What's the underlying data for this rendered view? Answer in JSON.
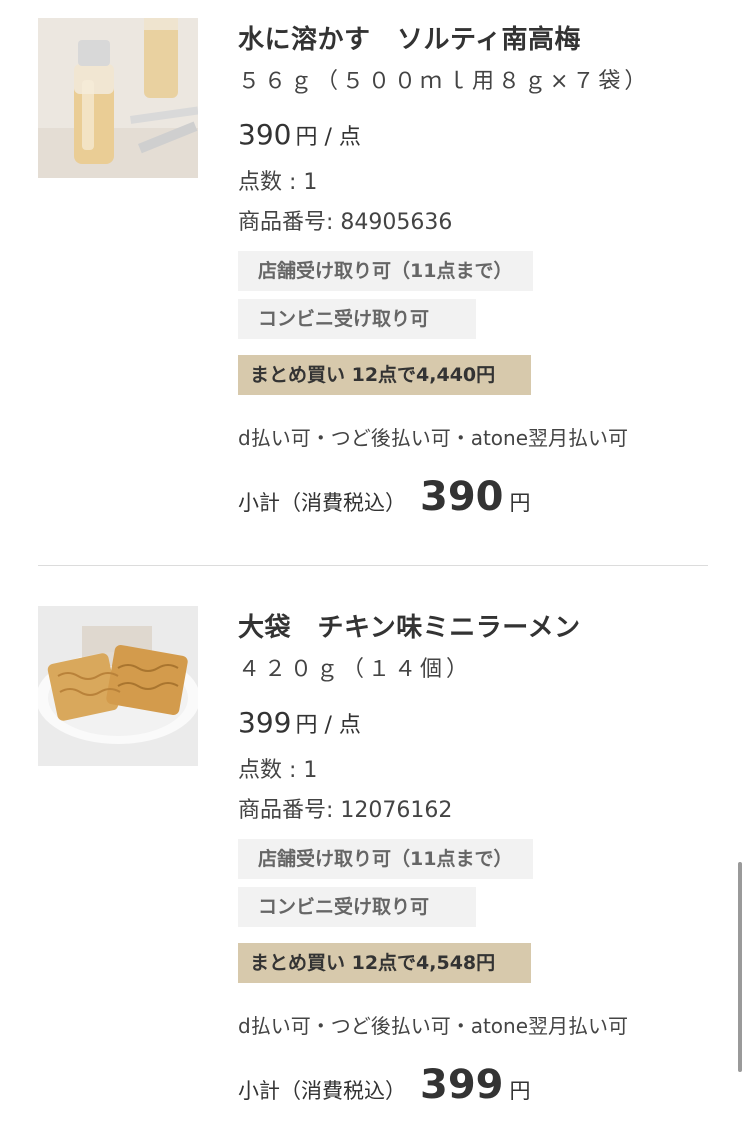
{
  "items": [
    {
      "image_alt": "水に溶かす ソルティ南高梅",
      "title": "水に溶かす　ソルティ南高梅",
      "subtitle": "５６ｇ（５００ｍｌ用８ｇ×７袋）",
      "price": "390",
      "price_unit": "円 / 点",
      "quantity": "点数 : 1",
      "sku": "商品番号: 84905636",
      "tag_store": "店舗受け取り可（11点まで）",
      "tag_conv": "コンビニ受け取り可",
      "tag_bulk": "まとめ買い 12点で4,440円",
      "payment": "d払い可・つど後払い可・atone翌月払い可",
      "subtotal_label": "小計（消費税込）",
      "subtotal_amount": "390",
      "subtotal_yen": "円"
    },
    {
      "image_alt": "大袋 チキン味ミニラーメン",
      "title": "大袋　チキン味ミニラーメン",
      "subtitle": "４２０ｇ（１４個）",
      "price": "399",
      "price_unit": "円 / 点",
      "quantity": "点数 : 1",
      "sku": "商品番号: 12076162",
      "tag_store": "店舗受け取り可（11点まで）",
      "tag_conv": "コンビニ受け取り可",
      "tag_bulk": "まとめ買い 12点で4,548円",
      "payment": "d払い可・つど後払い可・atone翌月払い可",
      "subtotal_label": "小計（消費税込）",
      "subtotal_amount": "399",
      "subtotal_yen": "円"
    }
  ],
  "colors": {
    "bulk_tag_bg": "#d7c9ac",
    "tag_bg": "#f2f2f2",
    "text": "#333333"
  }
}
